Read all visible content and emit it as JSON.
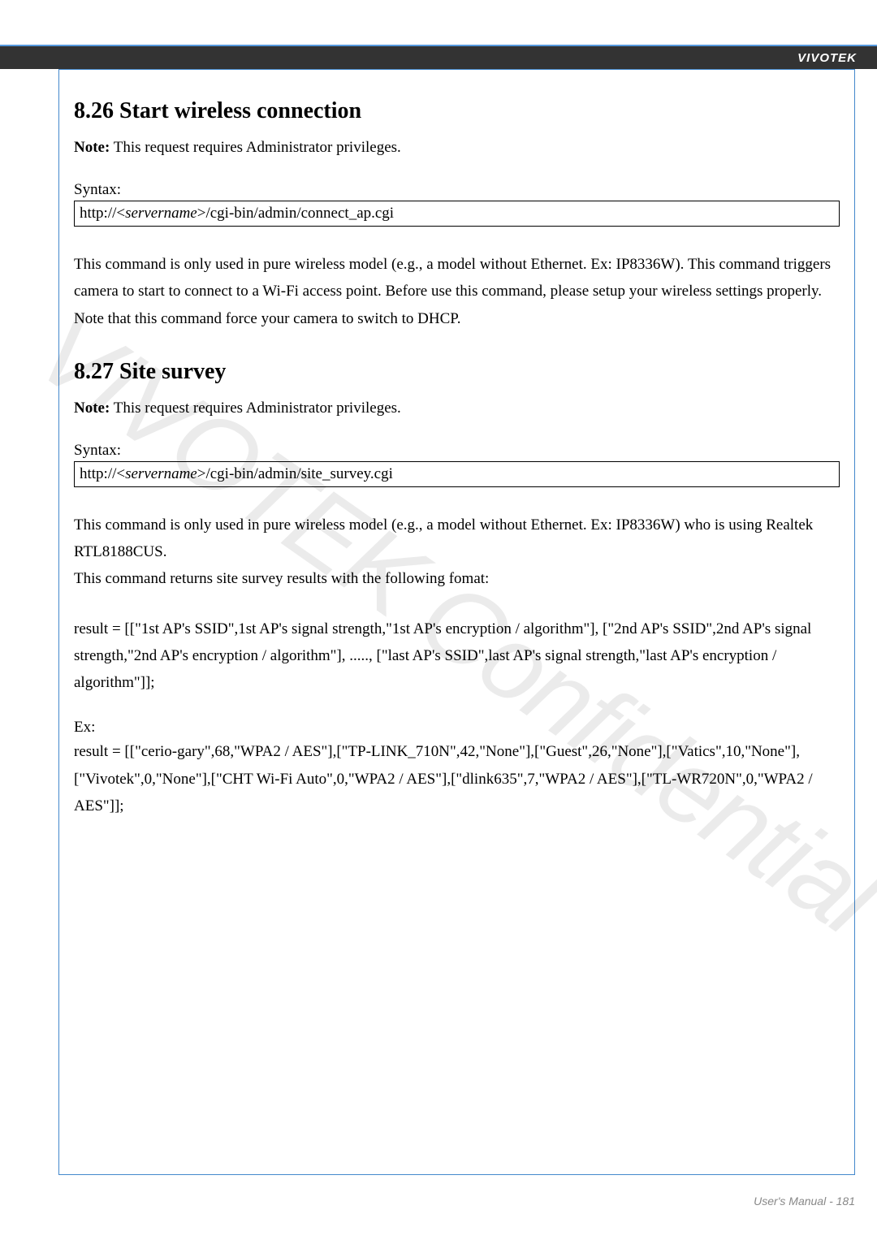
{
  "header": {
    "brand": "VIVOTEK"
  },
  "watermark": "VIVOTEK Confidential",
  "section1": {
    "heading": "8.26 Start wireless connection",
    "note_label": "Note:",
    "note_text": " This request requires Administrator privileges.",
    "syntax_label": "Syntax:",
    "syntax_prefix": "http://<",
    "syntax_server": "servername",
    "syntax_suffix": ">/cgi-bin/admin/connect_ap.cgi",
    "description": "This command is only used in pure wireless model (e.g., a model without Ethernet. Ex: IP8336W). This command triggers camera to start to connect to a Wi-Fi access point. Before use this command, please setup your wireless settings properly. Note that this command force your camera to switch to DHCP."
  },
  "section2": {
    "heading": "8.27 Site survey",
    "note_label": "Note:",
    "note_text": " This request requires Administrator privileges.",
    "syntax_label": "Syntax:",
    "syntax_prefix": "http://<",
    "syntax_server": "servername",
    "syntax_suffix": ">/cgi-bin/admin/site_survey.cgi",
    "description": "This command is only used in pure wireless model (e.g., a model without Ethernet. Ex: IP8336W) who is using Realtek RTL8188CUS.\nThis command returns site survey results with the following fomat:",
    "result_format": "result = [[\"1st AP's SSID\",1st AP's signal strength,\"1st AP's encryption / algorithm\"], [\"2nd AP's SSID\",2nd AP's signal strength,\"2nd AP's encryption / algorithm\"], ....., [\"last AP's SSID\",last AP's signal strength,\"last AP's encryption / algorithm\"]];",
    "ex_label": "Ex:",
    "ex_content": "result = [[\"cerio-gary\",68,\"WPA2 / AES\"],[\"TP-LINK_710N\",42,\"None\"],[\"Guest\",26,\"None\"],[\"Vatics\",10,\"None\"],[\"Vivotek\",0,\"None\"],[\"CHT Wi-Fi Auto\",0,\"WPA2 / AES\"],[\"dlink635\",7,\"WPA2 / AES\"],[\"TL-WR720N\",0,\"WPA2 / AES\"]];"
  },
  "footer": {
    "text": "User's Manual - 181"
  }
}
